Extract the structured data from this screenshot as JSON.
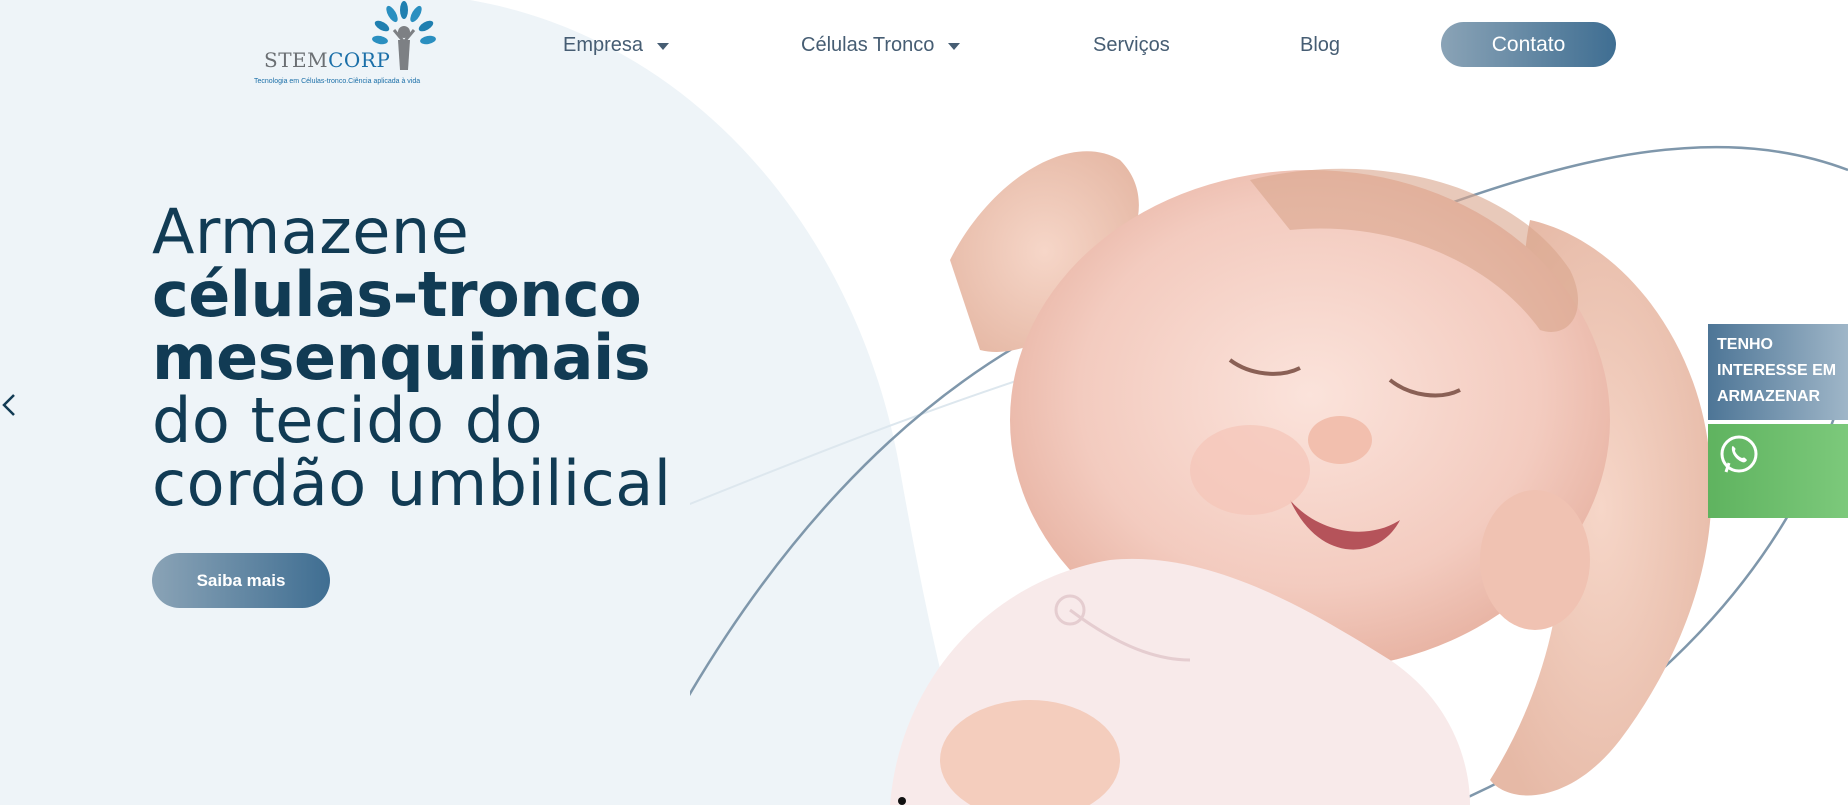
{
  "logo": {
    "word_stem": "Stem",
    "word_corp": "Corp",
    "tagline": "Tecnologia em Células-tronco.Ciência aplicada à vida",
    "icon": "tree-person-icon"
  },
  "nav": {
    "items": [
      {
        "label": "Empresa",
        "has_dropdown": true
      },
      {
        "label": "Células Tronco",
        "has_dropdown": true
      },
      {
        "label": "Serviços",
        "has_dropdown": false
      },
      {
        "label": "Blog",
        "has_dropdown": false
      }
    ],
    "contact_label": "Contato"
  },
  "hero": {
    "line1": "Armazene",
    "line2": "células-tronco",
    "line3": "mesenquimais",
    "line4": "do tecido do",
    "line5": "cordão umbilical",
    "cta_label": "Saiba mais"
  },
  "side_widget": {
    "interest_lines": [
      "TENHO",
      "INTERESSE EM",
      "ARMAZENAR"
    ],
    "whatsapp_icon": "whatsapp-icon"
  },
  "colors": {
    "heading": "#113b54",
    "nav_text": "#465d73",
    "button_gradient_start": "#8aa3b6",
    "button_gradient_end": "#3f6e92",
    "whatsapp_green": "#6cbe6b"
  },
  "carousel": {
    "prev_icon": "chevron-left-icon"
  }
}
